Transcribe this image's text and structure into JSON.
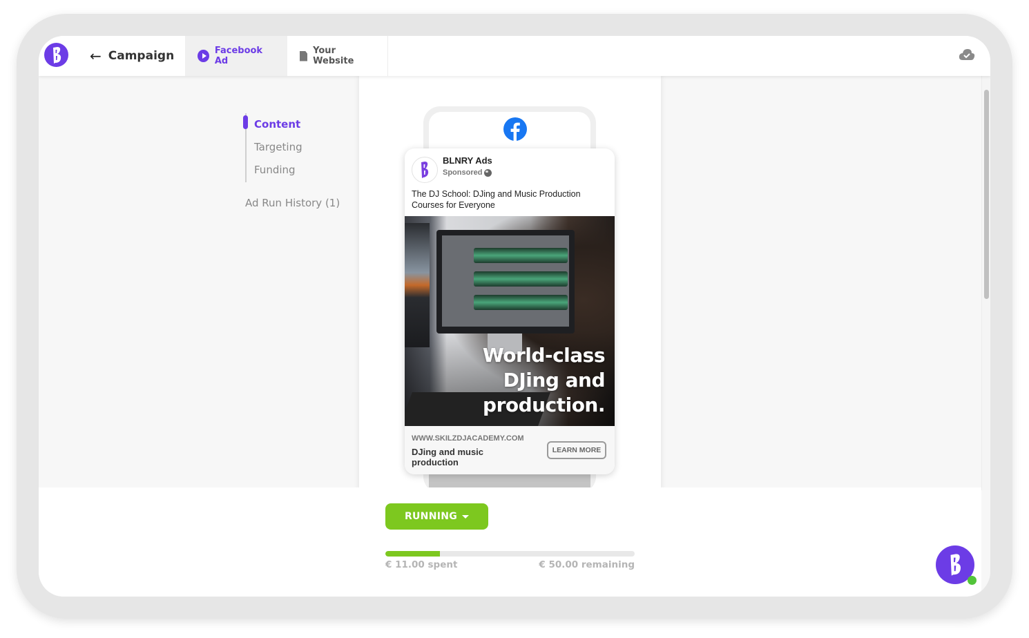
{
  "header": {
    "back_label": "Campaign",
    "tabs": [
      {
        "label": "Facebook Ad",
        "icon": "play-circle-icon",
        "active": true
      },
      {
        "label": "Your Website",
        "icon": "document-icon",
        "active": false
      }
    ],
    "sync_status_icon": "cloud-check-icon"
  },
  "steps": {
    "items": [
      {
        "label": "Content",
        "active": true
      },
      {
        "label": "Targeting",
        "active": false
      },
      {
        "label": "Funding",
        "active": false
      }
    ],
    "history_label": "Ad Run History (1)"
  },
  "ad": {
    "page_name": "BLNRY Ads",
    "sponsored_label": "Sponsored",
    "primary_text": "The DJ School: DJing and Music Production Courses for Everyone",
    "image_headline": [
      "World-class",
      "DJing and",
      "production."
    ],
    "display_url": "WWW.SKILZDJACADEMY.COM",
    "headline": "DJing and music production",
    "cta_label": "LEARN MORE"
  },
  "status": {
    "label": "RUNNING",
    "spent_label": "€ 11.00 spent",
    "remaining_label": "€ 50.00 remaining",
    "spent": 11.0,
    "remaining": 50.0,
    "currency": "€",
    "progress_fraction": 0.22
  },
  "colors": {
    "brand": "#6c3ce6",
    "running": "#7dc81f",
    "online_dot": "#52c43a",
    "facebook": "#1877f2"
  }
}
